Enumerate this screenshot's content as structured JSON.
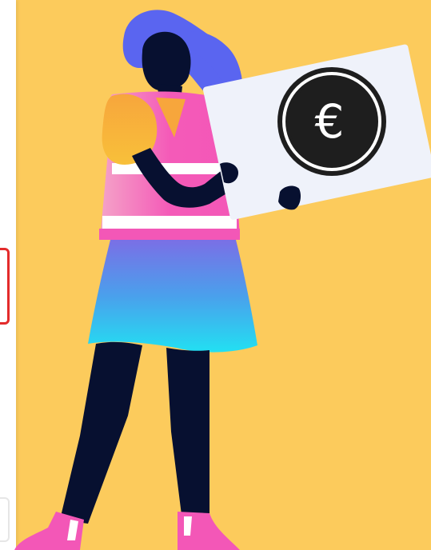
{
  "colors": {
    "background": "#fccb5c",
    "hair": "#5a65f0",
    "skin_dark": "#071030",
    "shirt": "#f357b7",
    "sleeve": "#f7a63c",
    "card": "#eff2fa",
    "coin": "#1e1e1e",
    "skirt_top": "#6b79e6",
    "skirt_bottom": "#22dbf0",
    "shoes": "#f357b7",
    "alert_border": "#e32b2b"
  },
  "icons": {
    "currency": "euro-icon"
  },
  "card": {
    "symbol": "€"
  }
}
